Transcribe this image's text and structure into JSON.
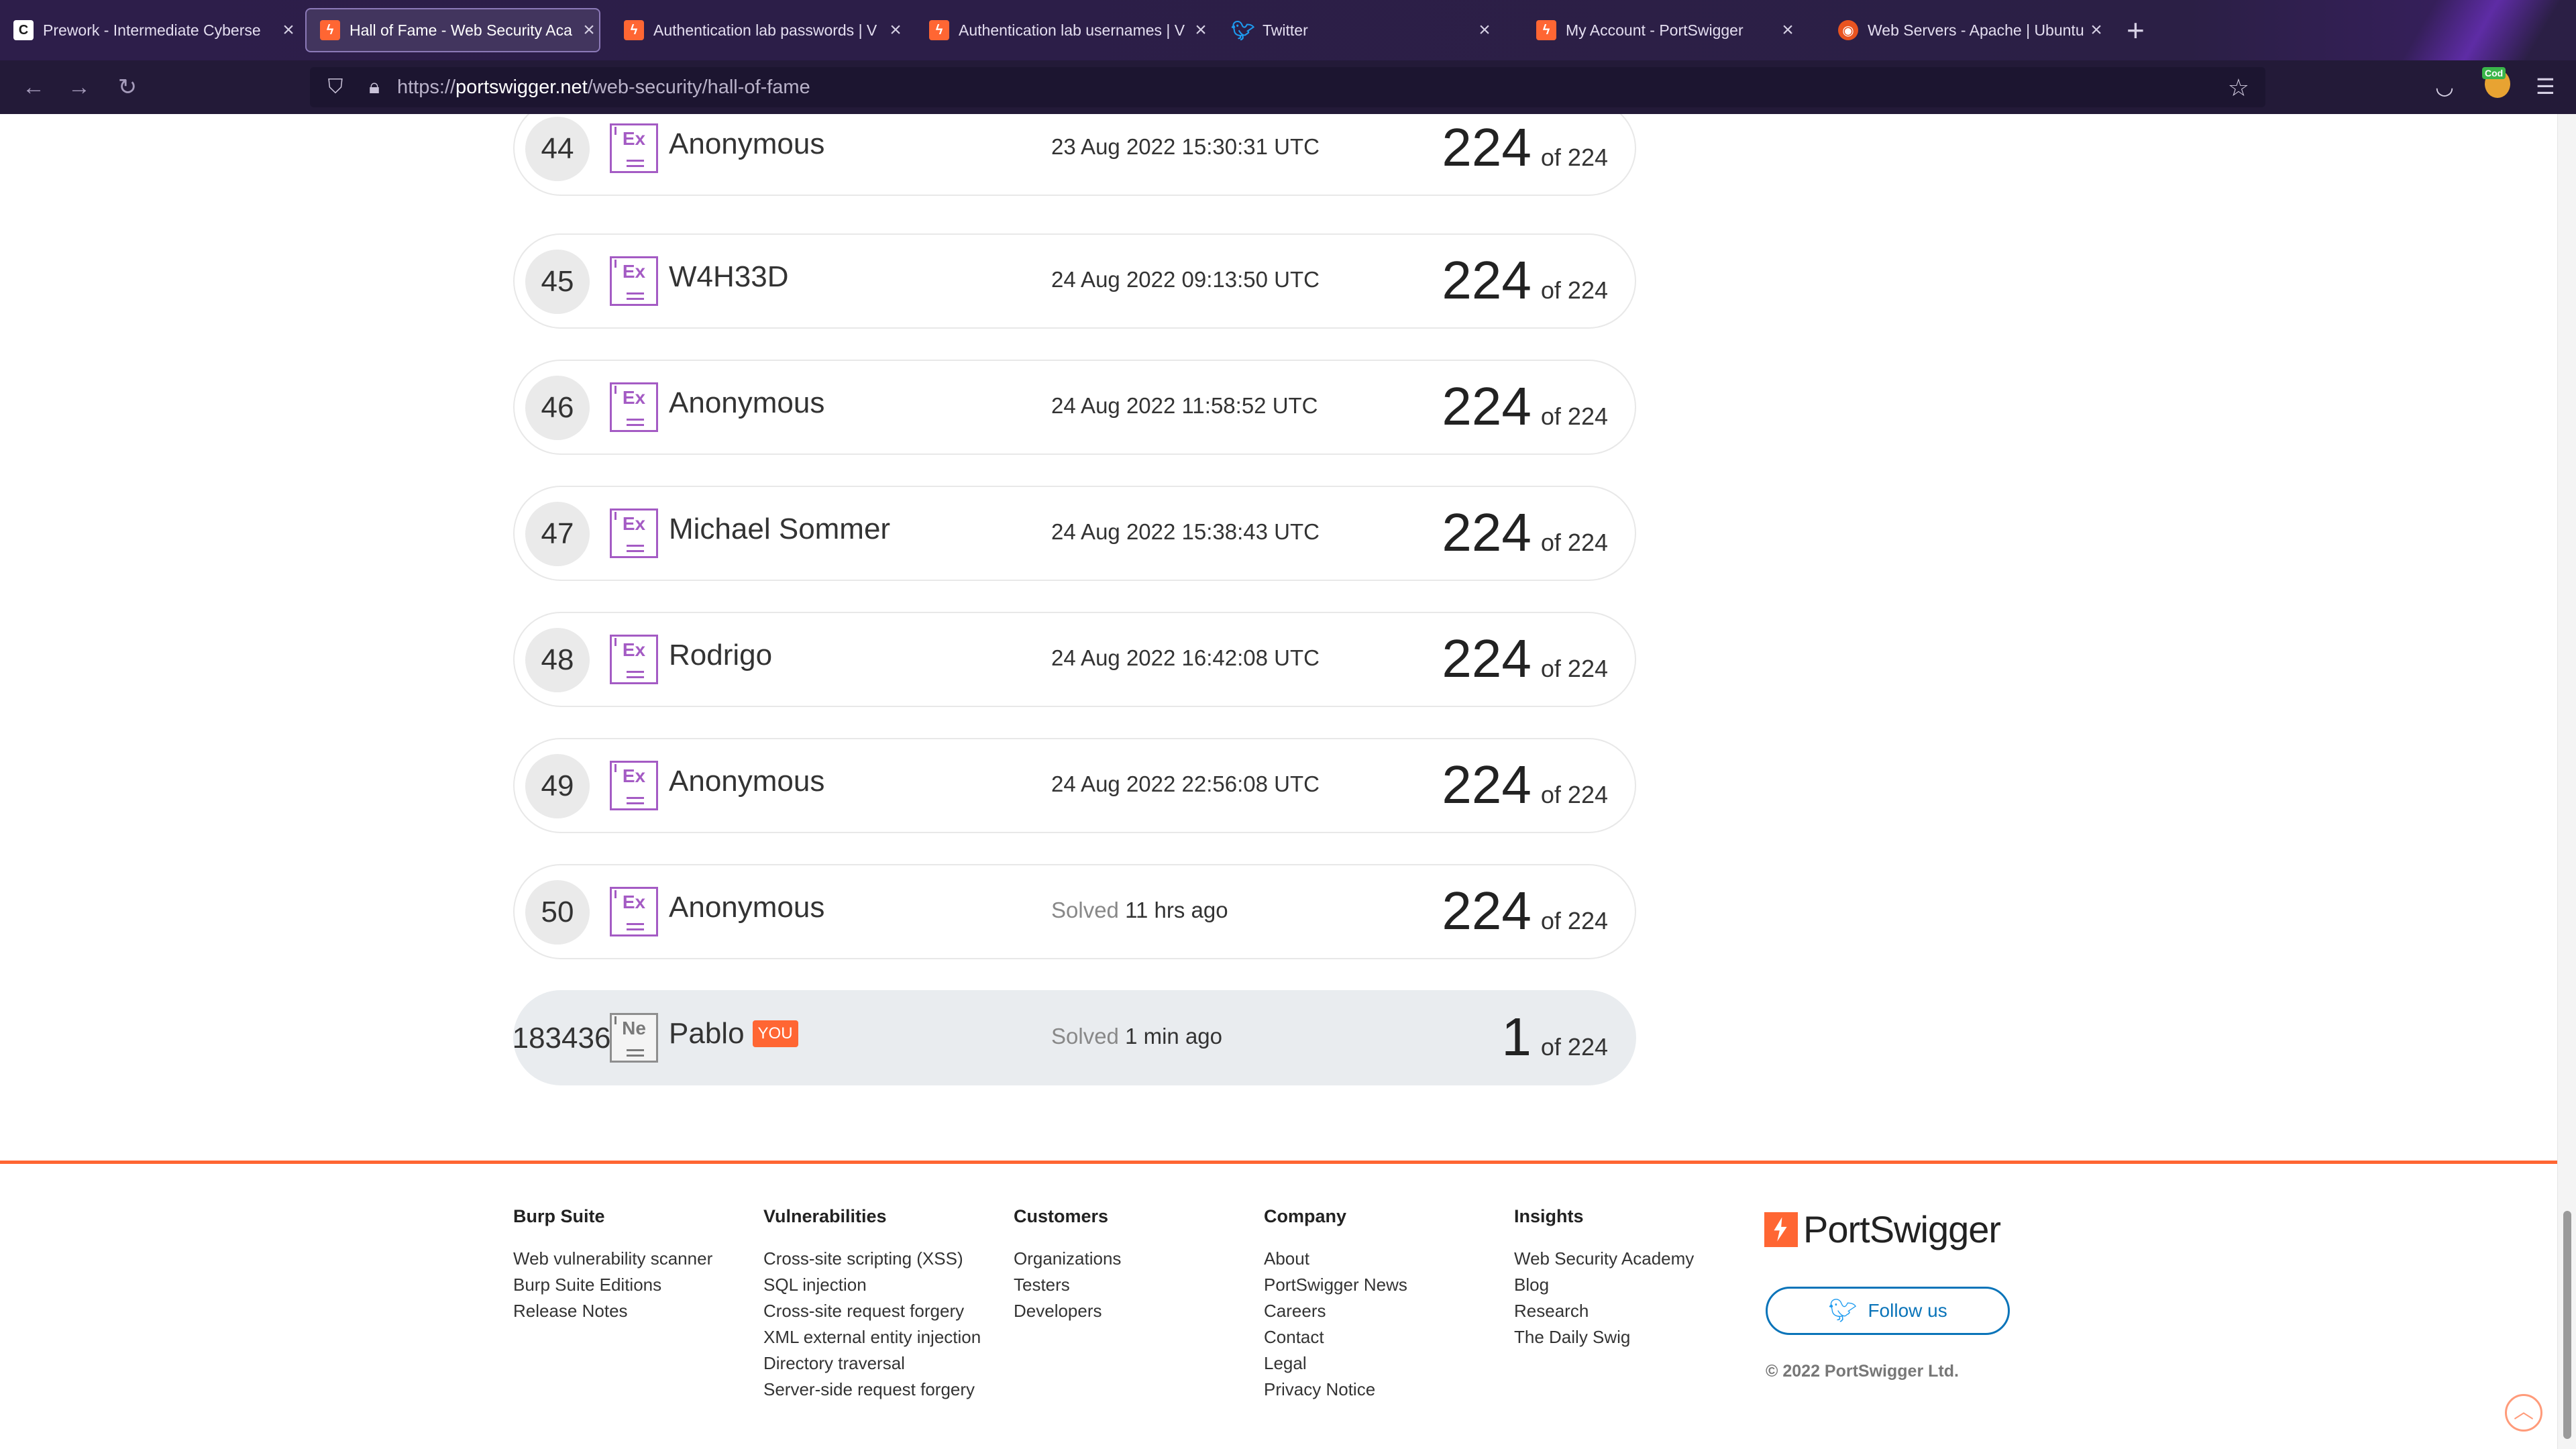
{
  "browser": {
    "tabs": [
      {
        "title": "Prework - Intermediate Cyberse",
        "icon": "c-icon",
        "active": false
      },
      {
        "title": "Hall of Fame - Web Security Aca",
        "icon": "portswigger-icon",
        "active": true
      },
      {
        "title": "Authentication lab passwords | V",
        "icon": "portswigger-icon",
        "active": false
      },
      {
        "title": "Authentication lab usernames | V",
        "icon": "portswigger-icon",
        "active": false
      },
      {
        "title": "Twitter",
        "icon": "twitter-icon",
        "active": false
      },
      {
        "title": "My Account - PortSwigger",
        "icon": "portswigger-icon",
        "active": false
      },
      {
        "title": "Web Servers - Apache | Ubuntu",
        "icon": "ubuntu-icon",
        "active": false
      }
    ],
    "url_prefix": "https://",
    "url_host": "portswigger.net",
    "url_path": "/web-security/hall-of-fame",
    "extension_badge": "Cod"
  },
  "leaderboard": [
    {
      "rank": "44",
      "badge": "Ex",
      "name": "Anonymous",
      "date_muted": "",
      "date": "23 Aug 2022 15:30:31 UTC",
      "score": "224",
      "total": "of 224",
      "you": false
    },
    {
      "rank": "45",
      "badge": "Ex",
      "name": "W4H33D",
      "date_muted": "",
      "date": "24 Aug 2022 09:13:50 UTC",
      "score": "224",
      "total": "of 224",
      "you": false
    },
    {
      "rank": "46",
      "badge": "Ex",
      "name": "Anonymous",
      "date_muted": "",
      "date": "24 Aug 2022 11:58:52 UTC",
      "score": "224",
      "total": "of 224",
      "you": false
    },
    {
      "rank": "47",
      "badge": "Ex",
      "name": "Michael Sommer",
      "date_muted": "",
      "date": "24 Aug 2022 15:38:43 UTC",
      "score": "224",
      "total": "of 224",
      "you": false
    },
    {
      "rank": "48",
      "badge": "Ex",
      "name": "Rodrigo",
      "date_muted": "",
      "date": "24 Aug 2022 16:42:08 UTC",
      "score": "224",
      "total": "of 224",
      "you": false
    },
    {
      "rank": "49",
      "badge": "Ex",
      "name": "Anonymous",
      "date_muted": "",
      "date": "24 Aug 2022 22:56:08 UTC",
      "score": "224",
      "total": "of 224",
      "you": false
    },
    {
      "rank": "50",
      "badge": "Ex",
      "name": "Anonymous",
      "date_muted": "Solved",
      "date": "11 hrs ago",
      "score": "224",
      "total": "of 224",
      "you": false
    },
    {
      "rank": "183436",
      "badge": "Ne",
      "name": "Pablo",
      "you_label": "YOU",
      "date_muted": "Solved",
      "date": "1 min ago",
      "score": "1",
      "total": "of 224",
      "you": true
    }
  ],
  "footer": {
    "columns": [
      {
        "heading": "Burp Suite",
        "links": [
          "Web vulnerability scanner",
          "Burp Suite Editions",
          "Release Notes"
        ]
      },
      {
        "heading": "Vulnerabilities",
        "links": [
          "Cross-site scripting (XSS)",
          "SQL injection",
          "Cross-site request forgery",
          "XML external entity injection",
          "Directory traversal",
          "Server-side request forgery"
        ]
      },
      {
        "heading": "Customers",
        "links": [
          "Organizations",
          "Testers",
          "Developers"
        ]
      },
      {
        "heading": "Company",
        "links": [
          "About",
          "PortSwigger News",
          "Careers",
          "Contact",
          "Legal",
          "Privacy Notice"
        ]
      },
      {
        "heading": "Insights",
        "links": [
          "Web Security Academy",
          "Blog",
          "Research",
          "The Daily Swig"
        ]
      }
    ],
    "logo_text": "PortSwigger",
    "follow_label": "Follow us",
    "copyright": "© 2022 PortSwigger Ltd."
  },
  "colors": {
    "accent": "#ff6633",
    "expert_badge": "#a45bc4",
    "twitter": "#1d9bf0",
    "browser_bg": "#2b1f45"
  }
}
